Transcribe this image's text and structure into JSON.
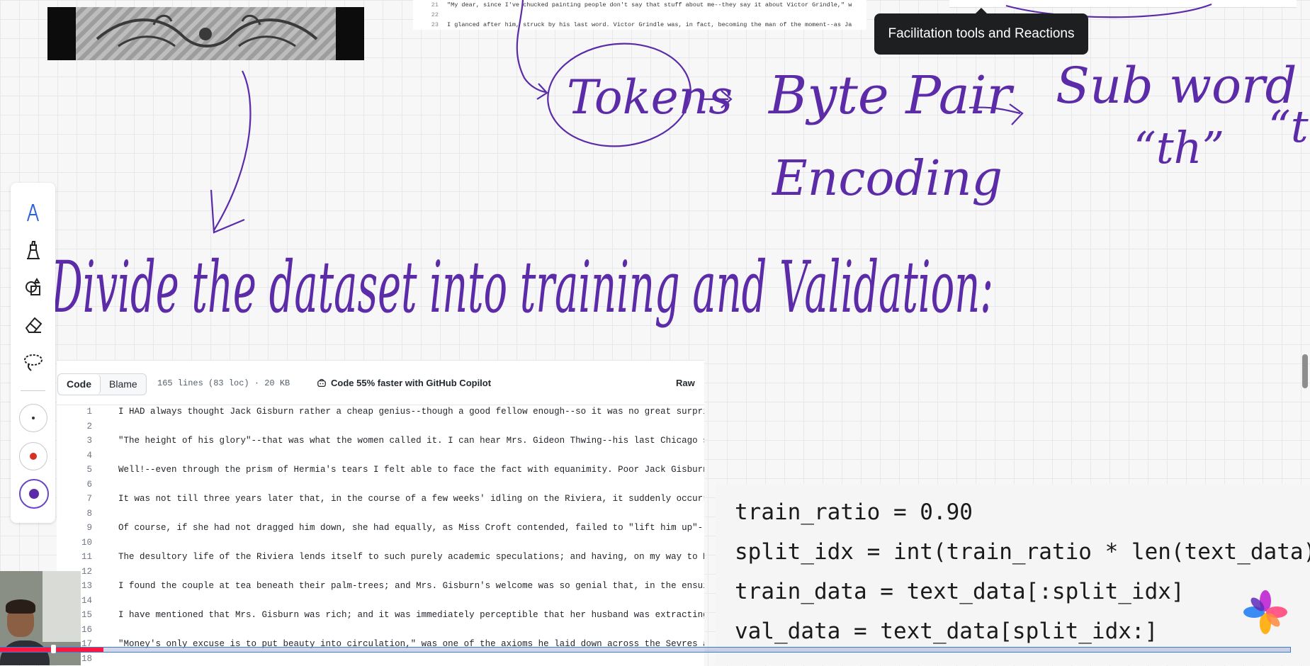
{
  "tooltip": {
    "text": "Facilitation tools and Reactions"
  },
  "ink": {
    "tokens": "Tokens",
    "byte_pair": "Byte Pair",
    "encoding": "Encoding",
    "sub_word": "Sub word",
    "th": "“th”",
    "t_partial": "“t",
    "heading": "Divide the dataset into training and Validation:"
  },
  "mini_code": {
    "lines": [
      {
        "num": "21",
        "text": "\"My dear, since I've chucked painting people don't say that stuff about me--they say it about Victor Grindle,\" w"
      },
      {
        "num": "22",
        "text": ""
      },
      {
        "num": "23",
        "text": "I glanced after him, struck by his last word. Victor Grindle was, in fact, becoming the man of the moment--as Ja"
      }
    ]
  },
  "palette": {
    "tools": [
      "pen-tool",
      "highlighter-tool",
      "shapes-tool",
      "eraser-tool",
      "lasso-tool"
    ],
    "sizes": [
      {
        "name": "small-dot",
        "color": "#333333"
      },
      {
        "name": "red-dot",
        "color": "#d93025"
      },
      {
        "name": "purple-dot",
        "color": "#5b2ba8"
      }
    ]
  },
  "github": {
    "tab_code": "Code",
    "tab_blame": "Blame",
    "meta": "165 lines (83 loc) · 20 KB",
    "copilot": "Code 55% faster with GitHub Copilot",
    "raw": "Raw",
    "lines": [
      {
        "num": "1",
        "text": "I HAD always thought Jack Gisburn rather a cheap genius--though a good fellow enough--so it was no great surprise"
      },
      {
        "num": "2",
        "text": ""
      },
      {
        "num": "3",
        "text": "\"The height of his glory\"--that was what the women called it. I can hear Mrs. Gideon Thwing--his last Chicago sitter"
      },
      {
        "num": "4",
        "text": ""
      },
      {
        "num": "5",
        "text": "Well!--even through the prism of Hermia's tears I felt able to face the fact with equanimity. Poor Jack Gisburn! The"
      },
      {
        "num": "6",
        "text": ""
      },
      {
        "num": "7",
        "text": "It was not till three years later that, in the course of a few weeks' idling on the Riviera, it suddenly occurred to"
      },
      {
        "num": "8",
        "text": ""
      },
      {
        "num": "9",
        "text": "Of course, if she had not dragged him down, she had equally, as Miss Croft contended, failed to \"lift him up\"--she"
      },
      {
        "num": "10",
        "text": ""
      },
      {
        "num": "11",
        "text": "The desultory life of the Riviera lends itself to such purely academic speculations; and having, on my way to Monte"
      },
      {
        "num": "12",
        "text": ""
      },
      {
        "num": "13",
        "text": "I found the couple at tea beneath their palm-trees; and Mrs. Gisburn's welcome was so genial that, in the ensuing"
      },
      {
        "num": "14",
        "text": ""
      },
      {
        "num": "15",
        "text": "I have mentioned that Mrs. Gisburn was rich; and it was immediately perceptible that her husband was extracting from"
      },
      {
        "num": "16",
        "text": ""
      },
      {
        "num": "17",
        "text": "\"Money's only excuse is to put beauty into circulation,\" was one of the axioms he laid down across the Sevres and"
      },
      {
        "num": "18",
        "text": ""
      }
    ]
  },
  "python": {
    "lines": [
      "train_ratio = 0.90",
      "split_idx = int(train_ratio * len(text_data))",
      "train_data = text_data[:split_idx]",
      "val_data = text_data[split_idx:]"
    ]
  },
  "video": {
    "progress": 0.08
  },
  "colors": {
    "ink": "#5b2ba8",
    "tooltip_bg": "#1e1f21",
    "progress": "#ff1744"
  }
}
